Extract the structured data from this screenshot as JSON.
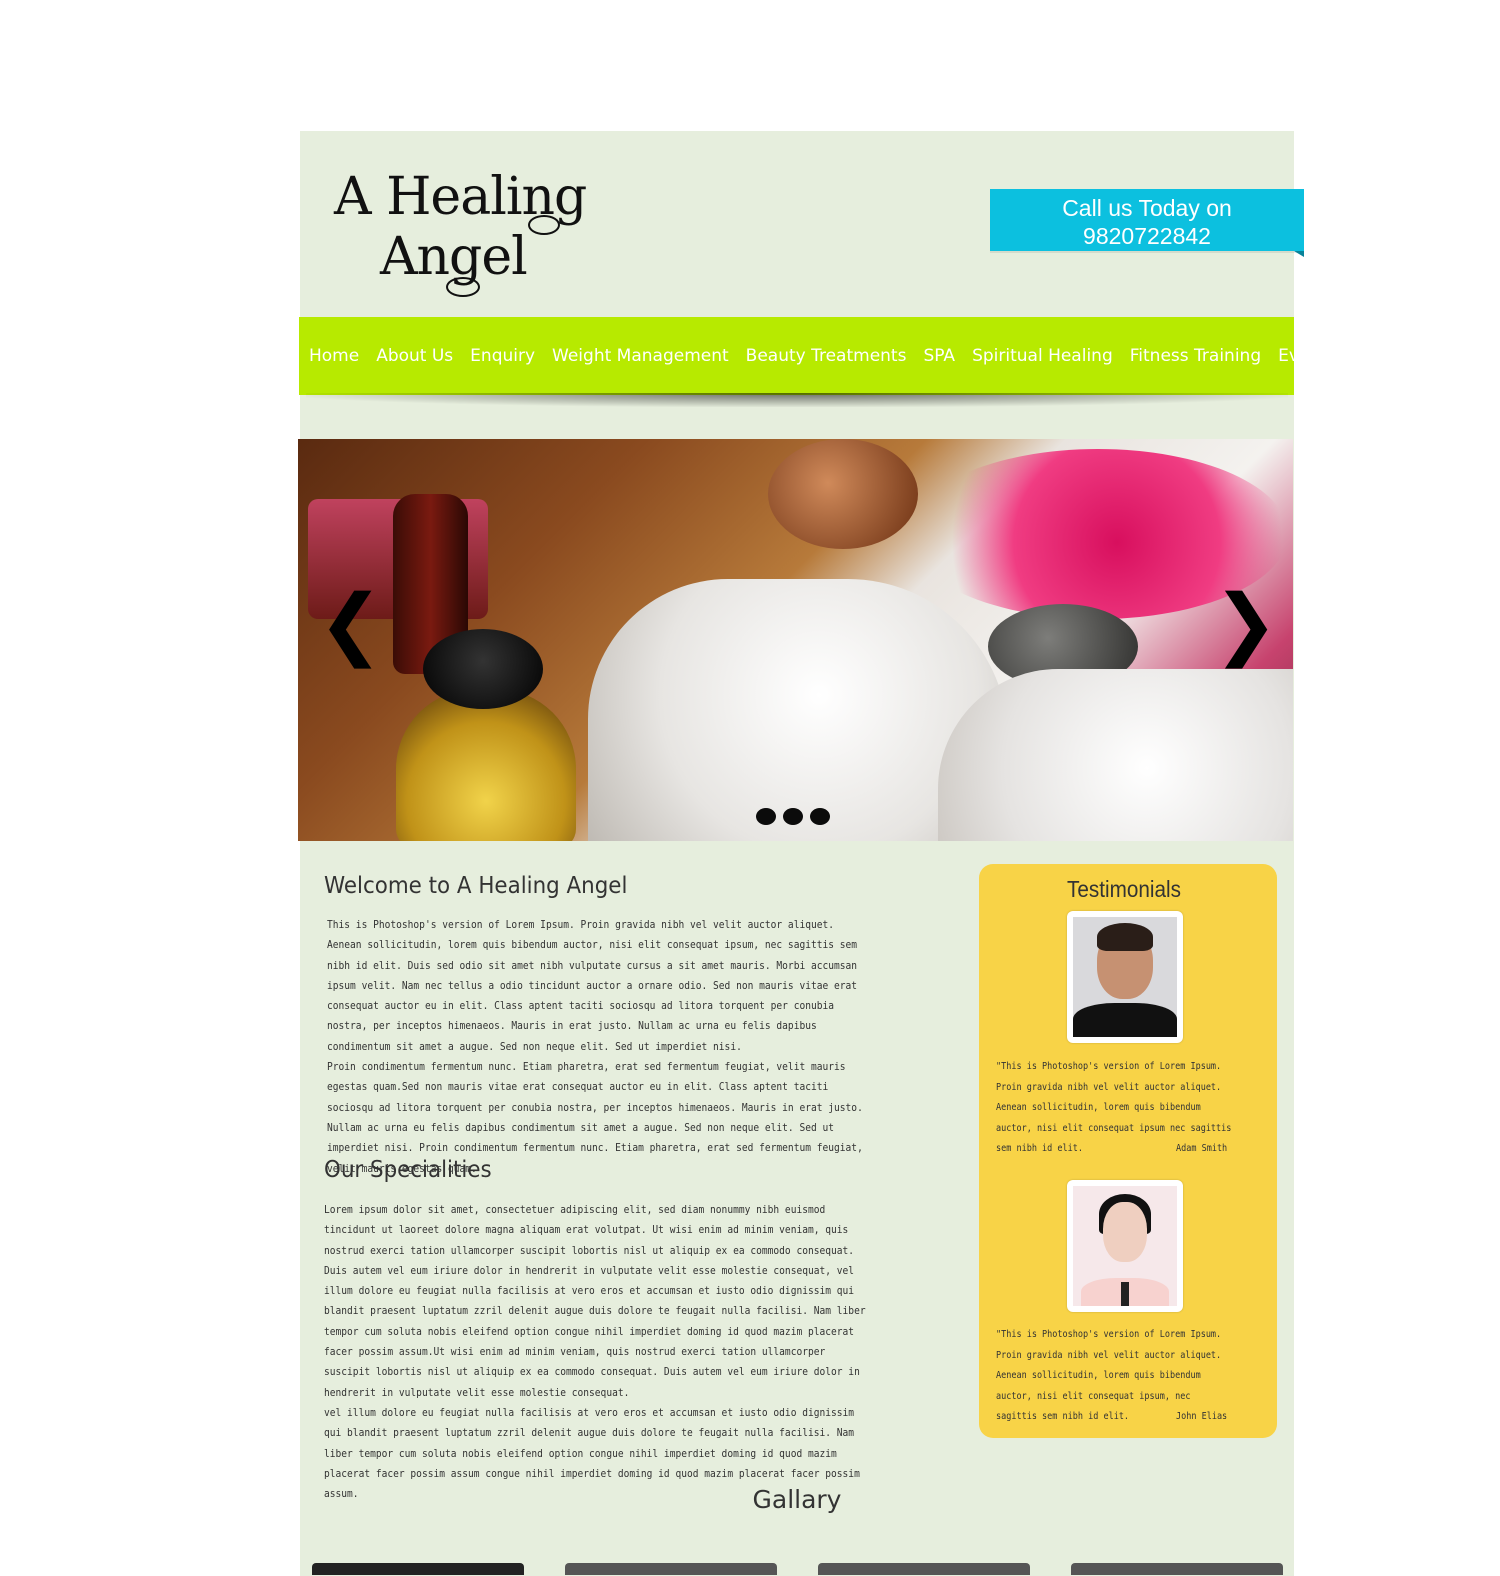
{
  "brand": {
    "logo_line1": "A Healing",
    "logo_line2": "Angel"
  },
  "callout": {
    "line1": "Call us  Today on",
    "line2": "9820722842",
    "color": "#0cc0df"
  },
  "nav": {
    "bg_color": "#b7ea00",
    "items": [
      "Home",
      "About Us",
      "Enquiry",
      "Weight Management",
      "Beauty Treatments",
      "SPA",
      "Spiritual Healing",
      "Fitness Training",
      "Events"
    ]
  },
  "slider": {
    "prev_glyph": "❮",
    "next_glyph": "❯",
    "dots": 3
  },
  "welcome": {
    "title": "Welcome to A Healing Angel",
    "p1": "This is Photoshop's version  of Lorem Ipsum. Proin gravida nibh vel velit auctor aliquet. Aenean sollicitudin, lorem quis bibendum auctor, nisi elit consequat ipsum, nec sagittis sem nibh id elit. Duis sed odio sit amet nibh vulputate cursus a sit amet mauris. Morbi accumsan ipsum velit. Nam nec tellus a odio tincidunt auctor a ornare odio. Sed non  mauris vitae erat consequat auctor eu in elit. Class aptent taciti sociosqu ad litora torquent per conubia nostra, per inceptos himenaeos. Mauris in erat justo. Nullam ac urna eu felis dapibus condimentum sit amet a augue. Sed non neque elit. Sed ut imperdiet nisi.",
    "p2": "Proin condimentum fermentum nunc. Etiam pharetra, erat sed fermentum feugiat, velit mauris egestas quam.Sed non mauris vitae erat consequat auctor eu in elit. Class aptent taciti sociosqu ad litora torquent per conubia nostra, per inceptos himenaeos. Mauris in erat justo. Nullam ac urna eu felis dapibus condimentum sit amet a augue. Sed non neque elit. Sed ut imperdiet nisi. Proin condimentum fermentum nunc. Etiam pharetra, erat sed fermentum feugiat, velit mauris egestas quam."
  },
  "specialities": {
    "title": "Our Specialities",
    "p1": "Lorem ipsum dolor sit amet, consectetuer adipiscing elit, sed diam nonummy nibh euismod tincidunt ut laoreet dolore magna aliquam erat volutpat. Ut wisi enim ad minim veniam, quis nostrud exerci tation ullamcorper suscipit lobortis nisl ut aliquip ex ea commodo consequat. Duis autem vel eum iriure dolor in hendrerit in vulputate velit esse molestie consequat, vel illum dolore eu feugiat nulla facilisis at vero eros et accumsan et iusto odio dignissim qui blandit praesent luptatum zzril delenit augue duis dolore te feugait nulla facilisi. Nam liber tempor cum soluta nobis eleifend option congue nihil imperdiet doming id quod mazim placerat facer possim assum.Ut wisi enim ad minim veniam, quis nostrud exerci tation ullamcorper suscipit lobortis nisl ut aliquip ex ea commodo consequat. Duis autem vel eum iriure dolor in hendrerit in vulputate velit esse molestie consequat.",
    "p2": "vel illum dolore eu feugiat nulla facilisis at vero eros et accumsan et iusto odio dignissim qui blandit praesent luptatum zzril delenit augue duis dolore te feugait nulla facilisi. Nam liber tempor cum soluta nobis eleifend option congue nihil imperdiet doming id quod mazim placerat facer possim assum congue nihil imperdiet doming id quod mazim placerat facer possim assum."
  },
  "testimonials": {
    "title": "Testimonials",
    "bg_color": "#f8d347",
    "items": [
      {
        "quote": "\"This is Photoshop's version  of Lorem Ipsum. Proin gravida nibh vel velit auctor aliquet. Aenean sollicitudin, lorem quis bibendum auctor, nisi elit consequat ipsum nec sagittis sem nibh id elit.",
        "author": "Adam Smith"
      },
      {
        "quote": "\"This is Photoshop's version  of Lorem Ipsum. Proin gravida nibh vel velit auctor aliquet. Aenean sollicitudin, lorem quis bibendum auctor, nisi elit consequat ipsum, nec sagittis sem nibh id elit.",
        "author": "John Elias"
      }
    ]
  },
  "gallery": {
    "title": "Gallary"
  },
  "colors": {
    "page_bg": "#e6eedd"
  }
}
